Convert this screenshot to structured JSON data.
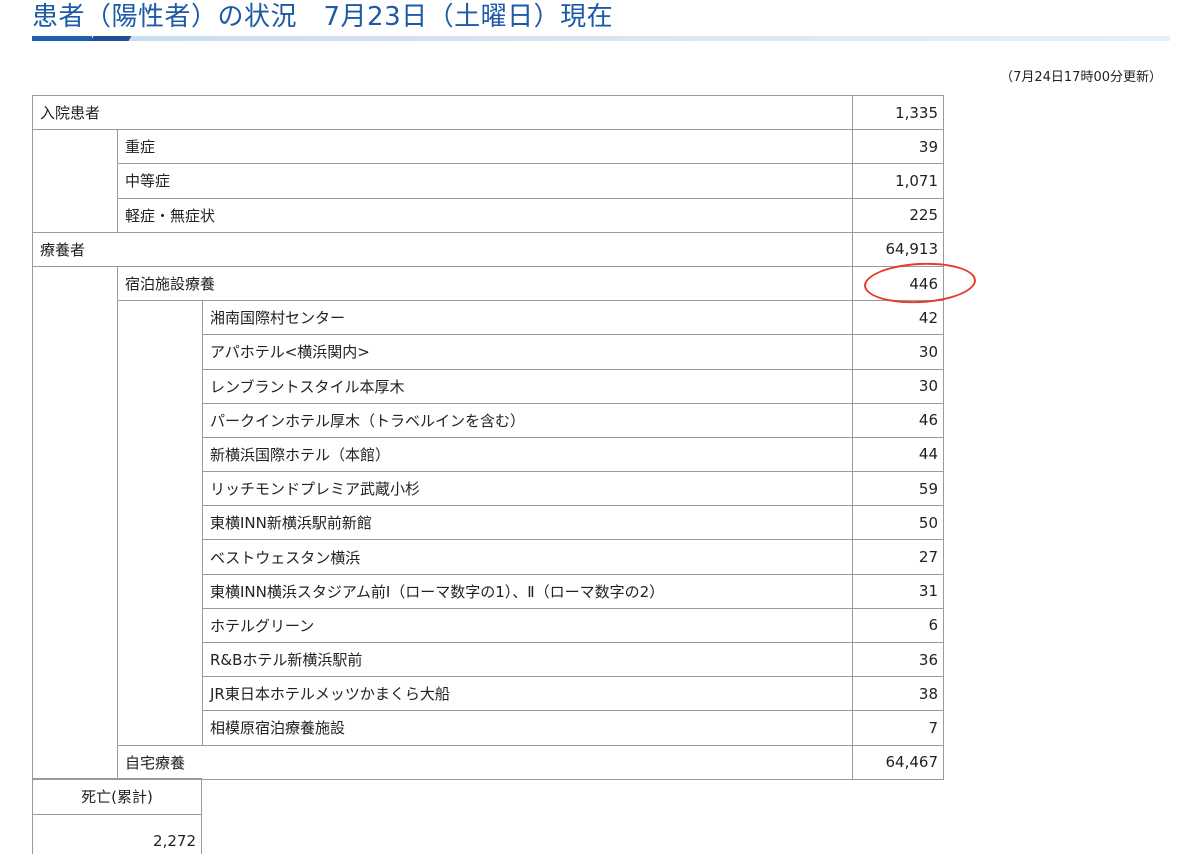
{
  "header": {
    "title": "患者（陽性者）の状況　7月23日（土曜日）現在",
    "updated": "（7月24日17時00分更新）"
  },
  "hospitalized": {
    "label": "入院患者",
    "value": "1,335",
    "items": [
      {
        "label": "重症",
        "value": "39"
      },
      {
        "label": "中等症",
        "value": "1,071"
      },
      {
        "label": "軽症・無症状",
        "value": "225"
      }
    ]
  },
  "recuperating": {
    "label": "療養者",
    "value": "64,913",
    "lodging": {
      "label": "宿泊施設療養",
      "value": "446",
      "facilities": [
        {
          "name": "湘南国際村センター",
          "value": "42"
        },
        {
          "name": "アパホテル<横浜関内>",
          "value": "30"
        },
        {
          "name": "レンブラントスタイル本厚木",
          "value": "30"
        },
        {
          "name": "パークインホテル厚木（トラベルインを含む）",
          "value": "46"
        },
        {
          "name": "新横浜国際ホテル（本館）",
          "value": "44"
        },
        {
          "name": "リッチモンドプレミア武蔵小杉",
          "value": "59"
        },
        {
          "name": "東横INN新横浜駅前新館",
          "value": "50"
        },
        {
          "name": "ベストウェスタン横浜",
          "value": "27"
        },
        {
          "name": "東横INN横浜スタジアム前Ⅰ（ローマ数字の1）、Ⅱ（ローマ数字の2）",
          "value": "31"
        },
        {
          "name": "ホテルグリーン",
          "value": "6"
        },
        {
          "name": "R&Bホテル新横浜駅前",
          "value": "36"
        },
        {
          "name": "JR東日本ホテルメッツかまくら大船",
          "value": "38"
        },
        {
          "name": "相模原宿泊療養施設",
          "value": "7"
        }
      ]
    },
    "home": {
      "label": "自宅療養",
      "value": "64,467"
    }
  },
  "deaths": {
    "label": "死亡(累計)",
    "value": "2,272"
  },
  "colors": {
    "title": "#1d5aa8",
    "highlight": "#e53a2a",
    "border": "#9a9a9a"
  }
}
